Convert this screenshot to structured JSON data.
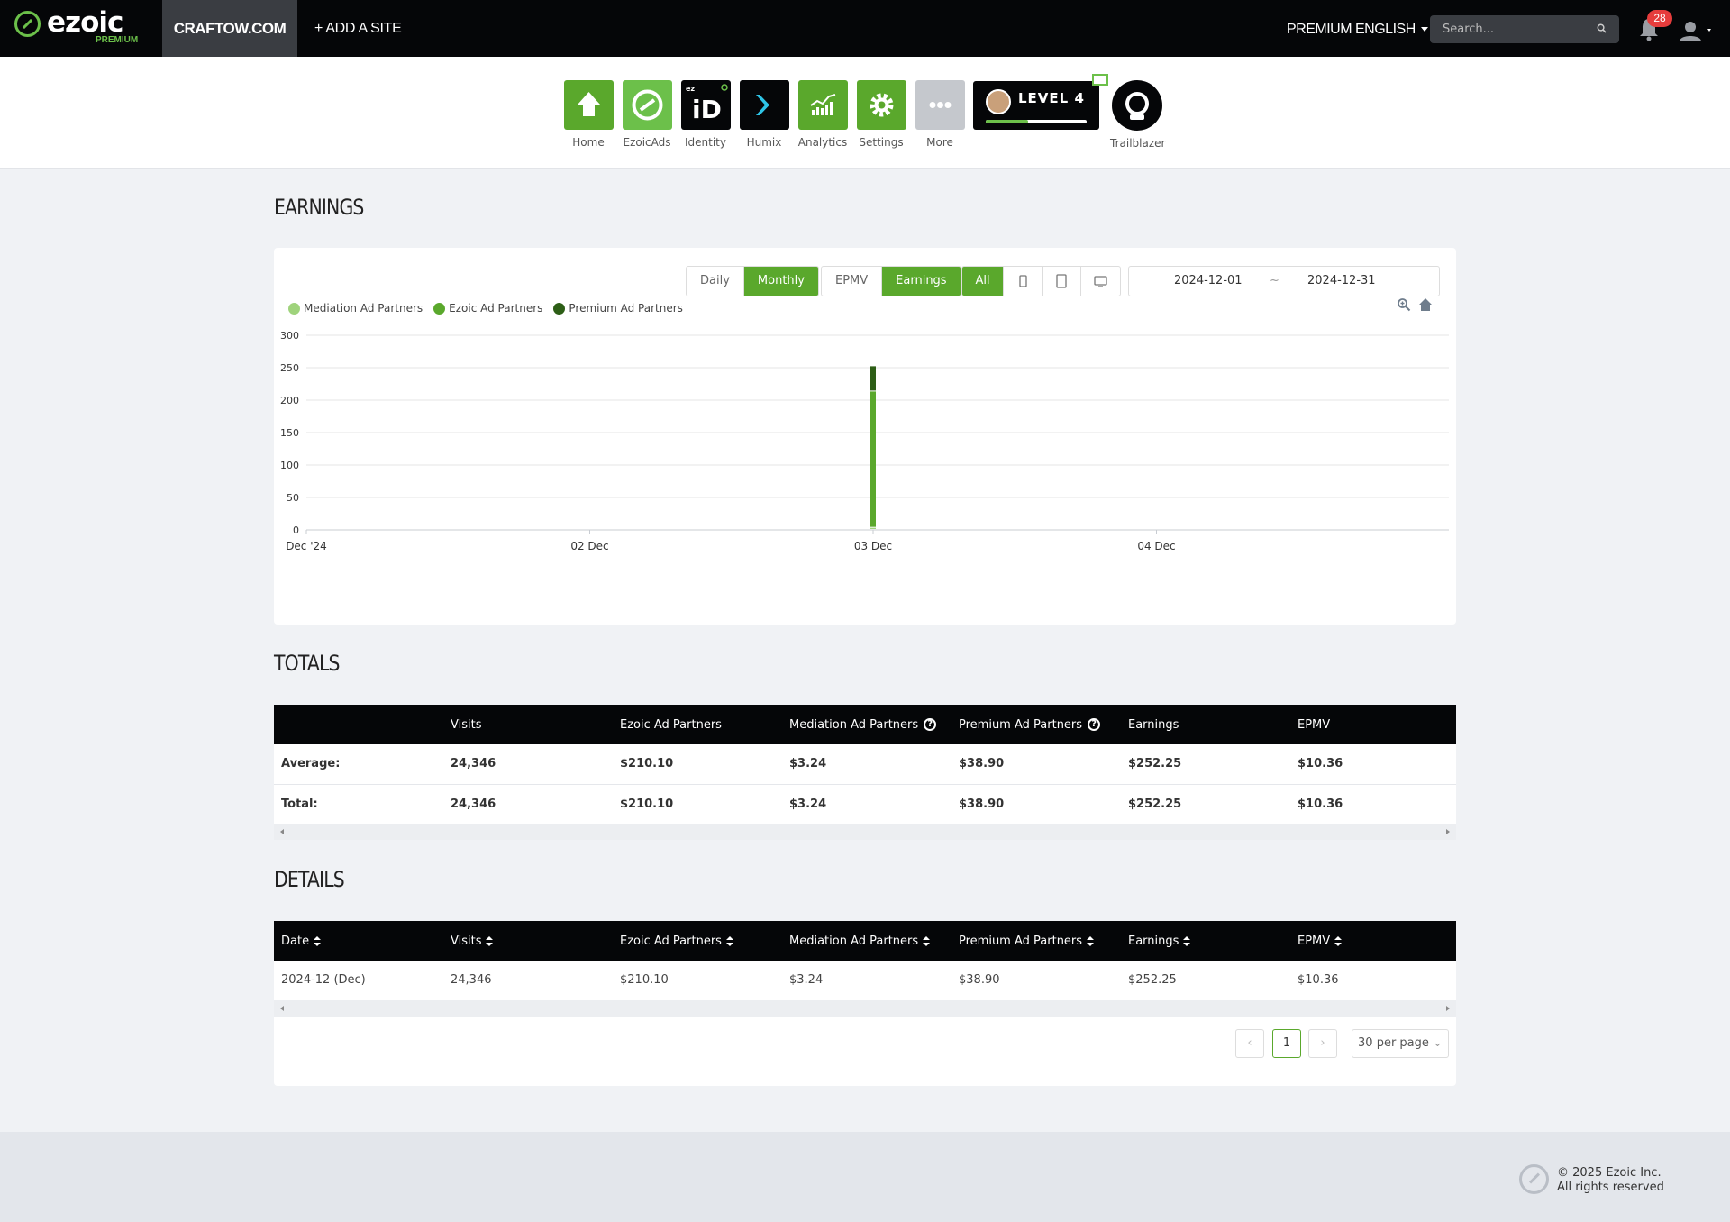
{
  "topbar": {
    "logo_text": "ezoic",
    "logo_sub": "PREMIUM",
    "site": "CRAFTOW.COM",
    "add_site": "+ ADD A SITE",
    "premium": "PREMIUM",
    "language": "ENGLISH",
    "search_placeholder": "Search...",
    "notification_count": "28"
  },
  "apps": [
    {
      "label": "Home",
      "icon": "home-icon",
      "color": "#5aa82c"
    },
    {
      "label": "EzoicAds",
      "icon": "ezoicads-icon",
      "color": "#6cc04a"
    },
    {
      "label": "Identity",
      "icon": "identity-icon",
      "color": "#050608"
    },
    {
      "label": "Humix",
      "icon": "humix-icon",
      "color": "#050608"
    },
    {
      "label": "Analytics",
      "icon": "analytics-icon",
      "color": "#5aa82c"
    },
    {
      "label": "Settings",
      "icon": "gear-icon",
      "color": "#5aa82c"
    },
    {
      "label": "More",
      "icon": "more-icon",
      "color": "#c5c8cd"
    }
  ],
  "level": {
    "text": "LEVEL 4",
    "progress": 0.42
  },
  "trailblazer": "Trailblazer",
  "earnings": {
    "title": "EARNINGS",
    "period_buttons": [
      "Daily",
      "Monthly"
    ],
    "period_active": "Monthly",
    "metric_buttons": [
      "EPMV",
      "Earnings"
    ],
    "metric_active": "Earnings",
    "device_all": "All",
    "date_from": "2024-12-01",
    "date_sep": "~",
    "date_to": "2024-12-31",
    "legend": [
      "Mediation Ad Partners",
      "Ezoic Ad Partners",
      "Premium Ad Partners"
    ]
  },
  "chart_data": {
    "type": "bar",
    "stacked": true,
    "x_tick_labels": [
      "Dec '24",
      "02 Dec",
      "03 Dec",
      "04 Dec"
    ],
    "categories": [
      "03 Dec"
    ],
    "series": [
      {
        "name": "Mediation Ad Partners",
        "color": "#9fd37c",
        "values": [
          3.24
        ]
      },
      {
        "name": "Ezoic Ad Partners",
        "color": "#5aa82c",
        "values": [
          210.1
        ]
      },
      {
        "name": "Premium Ad Partners",
        "color": "#2d5e16",
        "values": [
          38.9
        ]
      }
    ],
    "y_ticks": [
      0,
      50,
      100,
      150,
      200,
      250,
      300
    ],
    "ylim": [
      0,
      300
    ],
    "grid": true,
    "legend_position": "top-left"
  },
  "totals": {
    "title": "TOTALS",
    "headers": [
      "",
      "Visits",
      "Ezoic Ad Partners",
      "Mediation Ad Partners",
      "Premium Ad Partners",
      "Earnings",
      "EPMV"
    ],
    "rows": [
      [
        "Average:",
        "24,346",
        "$210.10",
        "$3.24",
        "$38.90",
        "$252.25",
        "$10.36"
      ],
      [
        "Total:",
        "24,346",
        "$210.10",
        "$3.24",
        "$38.90",
        "$252.25",
        "$10.36"
      ]
    ]
  },
  "details": {
    "title": "DETAILS",
    "headers": [
      "Date",
      "Visits",
      "Ezoic Ad Partners",
      "Mediation Ad Partners",
      "Premium Ad Partners",
      "Earnings",
      "EPMV"
    ],
    "rows": [
      [
        "2024-12 (Dec)",
        "24,346",
        "$210.10",
        "$3.24",
        "$38.90",
        "$252.25",
        "$10.36"
      ]
    ],
    "current_page": "1",
    "per_page": "30 per page"
  },
  "footer": {
    "line1": "© 2025 Ezoic Inc.",
    "line2": "All rights reserved"
  }
}
